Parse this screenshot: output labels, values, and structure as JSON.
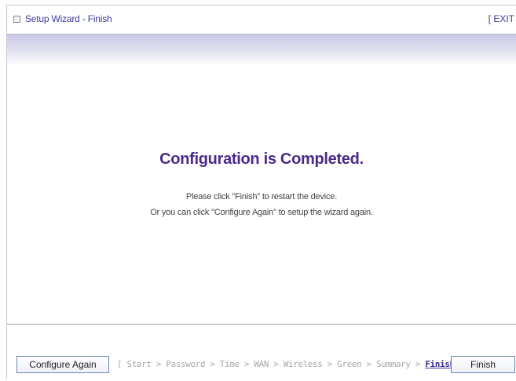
{
  "window": {
    "title": "Setup Wizard - Finish",
    "exit_label": "[ EXIT"
  },
  "main": {
    "headline": "Configuration is Completed.",
    "message_line1": "Please click \"Finish\" to restart the device.",
    "message_line2": "Or you can click \"Configure Again\" to setup the wizard again."
  },
  "footer": {
    "configure_again_label": "Configure Again",
    "finish_label": "Finish",
    "steps": {
      "open_bracket": "[",
      "items": [
        "Start",
        "Password",
        "Time",
        "WAN",
        "Wireless",
        "Green",
        "Summary"
      ],
      "separator": ">",
      "current": "Finish!",
      "close_bracket": "]"
    }
  },
  "colors": {
    "accent": "#3a3aa0",
    "headline": "#4a2a8a",
    "inactive_step": "#a8a8a8"
  }
}
